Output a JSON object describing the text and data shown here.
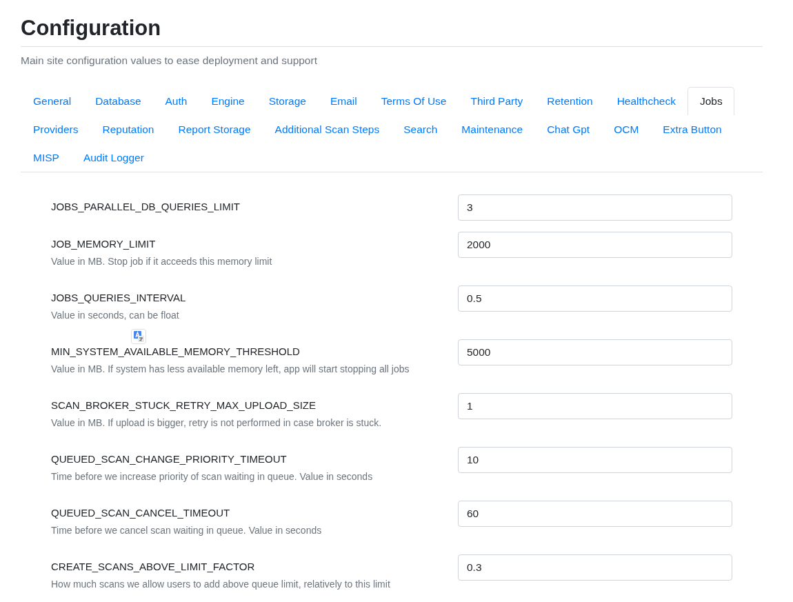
{
  "page": {
    "title": "Configuration",
    "subtitle": "Main site configuration values to ease deployment and support"
  },
  "tabs": [
    {
      "label": "General",
      "selected": false
    },
    {
      "label": "Database",
      "selected": false
    },
    {
      "label": "Auth",
      "selected": false
    },
    {
      "label": "Engine",
      "selected": false
    },
    {
      "label": "Storage",
      "selected": false
    },
    {
      "label": "Email",
      "selected": false
    },
    {
      "label": "Terms Of Use",
      "selected": false
    },
    {
      "label": "Third Party",
      "selected": false
    },
    {
      "label": "Retention",
      "selected": false
    },
    {
      "label": "Healthcheck",
      "selected": false
    },
    {
      "label": "Jobs",
      "selected": true
    },
    {
      "label": "Providers",
      "selected": false
    },
    {
      "label": "Reputation",
      "selected": false
    },
    {
      "label": "Report Storage",
      "selected": false
    },
    {
      "label": "Additional Scan Steps",
      "selected": false
    },
    {
      "label": "Search",
      "selected": false
    },
    {
      "label": "Maintenance",
      "selected": false
    },
    {
      "label": "Chat Gpt",
      "selected": false
    },
    {
      "label": "OCM",
      "selected": false
    },
    {
      "label": "Extra Button",
      "selected": false
    },
    {
      "label": "MISP",
      "selected": false
    },
    {
      "label": "Audit Logger",
      "selected": false
    }
  ],
  "settings": [
    {
      "name": "JOBS_PARALLEL_DB_QUERIES_LIMIT",
      "value": "3"
    },
    {
      "name": "JOB_MEMORY_LIMIT",
      "description": "Value in MB. Stop job if it acceeds this memory limit",
      "value": "2000"
    },
    {
      "name": "JOBS_QUERIES_INTERVAL",
      "description": "Value in seconds, can be float",
      "value": "0.5"
    },
    {
      "name": "MIN_SYSTEM_AVAILABLE_MEMORY_THRESHOLD",
      "description": "Value in MB. If system has less available memory left, app will start stopping all jobs",
      "value": "5000"
    },
    {
      "name": "SCAN_BROKER_STUCK_RETRY_MAX_UPLOAD_SIZE",
      "description": "Value in MB. If upload is bigger, retry is not performed in case broker is stuck.",
      "value": "1"
    },
    {
      "name": "QUEUED_SCAN_CHANGE_PRIORITY_TIMEOUT",
      "description": "Time before we increase priority of scan waiting in queue. Value in seconds",
      "value": "10"
    },
    {
      "name": "QUEUED_SCAN_CANCEL_TIMEOUT",
      "description": "Time before we cancel scan waiting in queue. Value in seconds",
      "value": "60"
    },
    {
      "name": "CREATE_SCANS_ABOVE_LIMIT_FACTOR",
      "description": "How much scans we allow users to add above queue limit, relatively to this limit",
      "value": "0.3"
    }
  ]
}
